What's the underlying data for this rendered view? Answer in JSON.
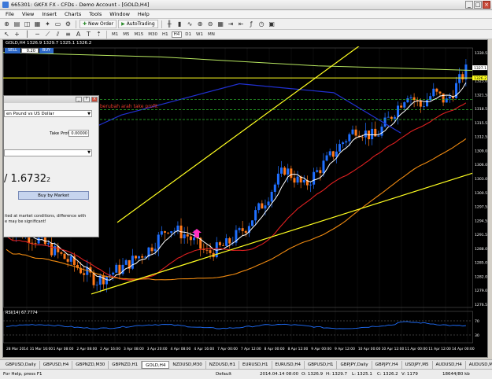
{
  "window": {
    "title": "665301: GKFX FX - CFDs - Demo Account - [GOLD,H4]"
  },
  "menu": [
    "File",
    "View",
    "Insert",
    "Charts",
    "Tools",
    "Window",
    "Help"
  ],
  "toolbar": {
    "new_order": "New Order",
    "autotrading": "AutoTrading",
    "timeframes": [
      "M1",
      "M5",
      "M15",
      "M30",
      "H1",
      "H4",
      "D1",
      "W1",
      "MN"
    ]
  },
  "chart": {
    "header": "GOLD,H4  1326.9 1329.7 1325.1 1326.2",
    "bg": "#000000",
    "bull_color": "#1f6fff",
    "bear_color": "#ff7a1a",
    "trend_note": "berubah arah take profit",
    "rsi_label": "RSI(14) 67.7774"
  },
  "one_click": {
    "sell": "SELL",
    "volume": "0.20",
    "buy": "BUY"
  },
  "order_window": {
    "symbol": "en Pound vs US Dollar",
    "take_profit_label": "Take Profit:",
    "take_profit_value": "0.00000",
    "price_main": "/ 1.6732",
    "price_sup": "2",
    "buy_button": "Buy by Market",
    "note": "ited at market conditions, difference with\ne may be significant!"
  },
  "price_axis": [
    "1330.5",
    "1326.2",
    "1325.0",
    "1321.5",
    "1318.5",
    "1315.5",
    "1312.5",
    "1309.0",
    "1306.0",
    "1303.0",
    "1300.5",
    "1297.5",
    "1294.5",
    "1291.5",
    "1288.0",
    "1285.0",
    "1282.0",
    "1279.0",
    "1276.5"
  ],
  "current_price": "1326.2",
  "line_price": "1327.1",
  "rsi_axis": [
    "70",
    "30"
  ],
  "time_axis": [
    "28 Mar 2014",
    "31 Mar 16:00",
    "1 Apr 08:00",
    "2 Apr 08:00",
    "2 Apr 16:00",
    "3 Apr 08:00",
    "3 Apr 20:00",
    "4 Apr 08:00",
    "4 Apr 16:00",
    "7 Apr 00:00",
    "7 Apr 12:00",
    "8 Apr 00:00",
    "8 Apr 12:00",
    "9 Apr 00:00",
    "9 Apr 12:00",
    "10 Apr 00:00",
    "10 Apr 12:00",
    "11 Apr 00:00",
    "11 Apr 12:00",
    "14 Apr 00:00"
  ],
  "tabs": [
    "GBPUSD,Daily",
    "GBPUSD,H4",
    "GBPNZD,M30",
    "GBPNZD,H1",
    "GOLD,H4",
    "NZDUSD,M30",
    "NZDUSD,H1",
    "EURUSD,H1",
    "EURUSD,H4",
    "GBPUSD,H1",
    "GBPJPY,Daily",
    "GBPJPY,H4",
    "USDJPY,M5",
    "AUDUSD,H4",
    "AUDUSD,M30"
  ],
  "active_tab": "GOLD,H4",
  "status": {
    "help": "For Help, press F1",
    "profile": "Default",
    "time": "2014.04.14 08:00",
    "open": "O: 1326.9",
    "high": "H: 1329.7",
    "low": "L: 1325.1",
    "close": "C: 1326.2",
    "volume": "V: 1179",
    "traffic": "18644/80 kb"
  }
}
